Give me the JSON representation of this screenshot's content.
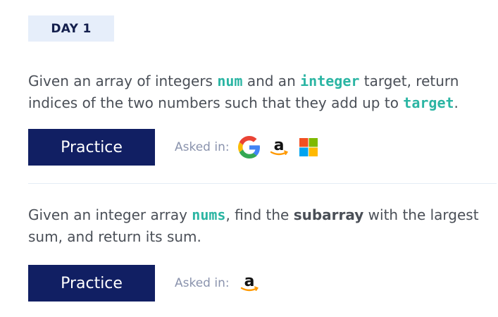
{
  "day_label": "DAY 1",
  "problems": [
    {
      "text_parts": [
        "Given an array of integers ",
        "num",
        " and an ",
        "integer",
        " target, return indices of the two numbers such that they add up to ",
        "target",
        "."
      ],
      "practice_label": "Practice",
      "asked_in_label": "Asked in:",
      "companies": [
        "google-logo",
        "amazon-logo",
        "microsoft-logo"
      ]
    },
    {
      "text_parts": [
        "Given an integer array ",
        "nums",
        ", find the ",
        "subarray",
        " with the largest sum, and return its sum."
      ],
      "practice_label": "Practice",
      "asked_in_label": "Asked in:",
      "companies": [
        "amazon-logo"
      ]
    }
  ],
  "colors": {
    "primary_button": "#111f63",
    "code_accent": "#2bb5a3",
    "badge_bg": "#e6eefa"
  }
}
